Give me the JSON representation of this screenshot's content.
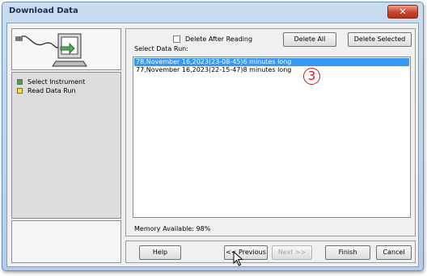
{
  "window": {
    "title": "Download Data",
    "close_symbol": "✕"
  },
  "steps": [
    {
      "label": "Select Instrument",
      "color": "#3fa845"
    },
    {
      "label": "Read Data Run",
      "color": "#f1df3a"
    }
  ],
  "toolbar": {
    "delete_after_reading_label": "Delete After Reading",
    "delete_after_reading_checked": false,
    "delete_all_label": "Delete All",
    "delete_selected_label": "Delete Selected"
  },
  "data_runs": {
    "label": "Select Data Run:",
    "items": [
      {
        "text": "78,November 16,2023(23-08-45)6 minutes long",
        "selected": true
      },
      {
        "text": "77,November 16,2023(22-15-47)8 minutes long",
        "selected": false
      }
    ]
  },
  "memory": {
    "label": "Memory Available: 98%"
  },
  "annotation": {
    "text": "3"
  },
  "footer": {
    "help_label": "Help",
    "previous_label": "<< Previous",
    "next_label": "Next >>",
    "finish_label": "Finish",
    "cancel_label": "Cancel"
  }
}
